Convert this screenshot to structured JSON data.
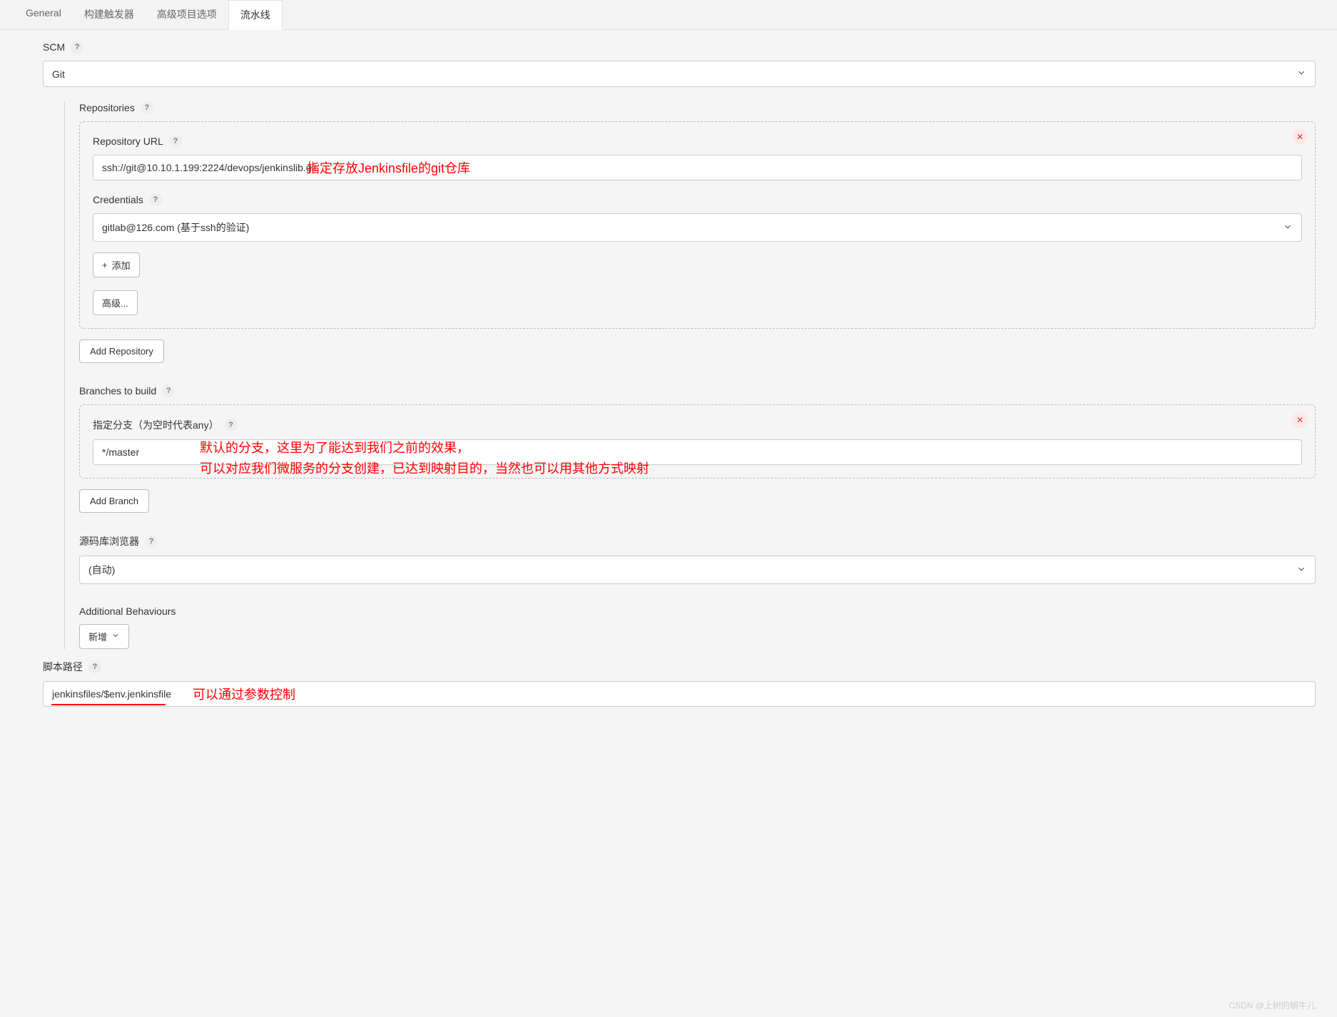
{
  "tabs": {
    "general": "General",
    "trigger": "构建触发器",
    "advanced": "高级项目选项",
    "pipeline": "流水线"
  },
  "scm": {
    "label": "SCM",
    "value": "Git"
  },
  "repositories": {
    "label": "Repositories",
    "url_label": "Repository URL",
    "url_value": "ssh://git@10.10.1.199:2224/devops/jenkinslib.git",
    "credentials_label": "Credentials",
    "credentials_value": "gitlab@126.com (基于ssh的验证)",
    "add_btn": "添加",
    "advanced_btn": "高级...",
    "add_repo_btn": "Add Repository"
  },
  "branches": {
    "label": "Branches to build",
    "spec_label": "指定分支（为空时代表any）",
    "spec_value": "*/master",
    "add_branch_btn": "Add Branch"
  },
  "browser": {
    "label": "源码库浏览器",
    "value": "(自动)"
  },
  "behaviours": {
    "label": "Additional Behaviours",
    "add_btn": "新增"
  },
  "script_path": {
    "label": "脚本路径",
    "value": "jenkinsfiles/$env.jenkinsfile"
  },
  "annotations": {
    "repo": "指定存放Jenkinsfile的git仓库",
    "branch_line1": "默认的分支，这里为了能达到我们之前的效果，",
    "branch_line2": "可以对应我们微服务的分支创建，已达到映射目的，当然也可以用其他方式映射",
    "script": "可以通过参数控制"
  },
  "watermark": "CSDN @上树的蜗牛儿"
}
